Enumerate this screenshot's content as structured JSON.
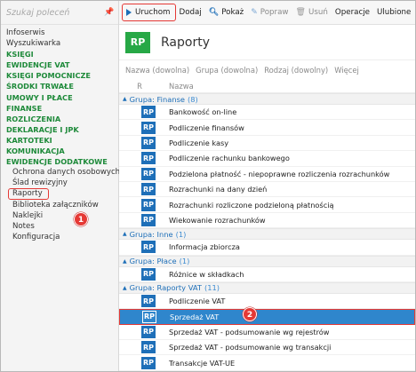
{
  "sidebar": {
    "search_placeholder": "Szukaj poleceń",
    "items": [
      {
        "label": "Infoserwis",
        "kind": "plain"
      },
      {
        "label": "Wyszukiwarka",
        "kind": "plain"
      },
      {
        "label": "KSIĘGI",
        "kind": "cat"
      },
      {
        "label": "EWIDENCJE VAT",
        "kind": "cat"
      },
      {
        "label": "KSIĘGI POMOCNICZE",
        "kind": "cat"
      },
      {
        "label": "ŚRODKI TRWAŁE",
        "kind": "cat"
      },
      {
        "label": "UMOWY I PŁACE",
        "kind": "cat"
      },
      {
        "label": "FINANSE",
        "kind": "cat"
      },
      {
        "label": "ROZLICZENIA",
        "kind": "cat"
      },
      {
        "label": "DEKLARACJE I JPK",
        "kind": "cat"
      },
      {
        "label": "KARTOTEKI",
        "kind": "cat"
      },
      {
        "label": "KOMUNIKACJA",
        "kind": "cat"
      },
      {
        "label": "EWIDENCJE DODATKOWE",
        "kind": "cat"
      },
      {
        "label": "Ochrona danych osobowych",
        "kind": "sub"
      },
      {
        "label": "Ślad rewizyjny",
        "kind": "sub"
      },
      {
        "label": "Raporty",
        "kind": "sub"
      },
      {
        "label": "Biblioteka załączników",
        "kind": "sub"
      },
      {
        "label": "Naklejki",
        "kind": "sub"
      },
      {
        "label": "Notes",
        "kind": "sub"
      },
      {
        "label": "Konfiguracja",
        "kind": "sub"
      }
    ]
  },
  "toolbar": {
    "run": "Uruchom",
    "add": "Dodaj",
    "show": "Pokaż",
    "fix": "Popraw",
    "delete": "Usuń",
    "operations": "Operacje",
    "favorites": "Ulubione"
  },
  "header": {
    "icon": "RP",
    "title": "Raporty"
  },
  "filters": [
    "Nazwa (dowolna)",
    "Grupa (dowolna)",
    "Rodzaj (dowolny)",
    "Więcej"
  ],
  "columns": {
    "r": "R",
    "name": "Nazwa"
  },
  "groups": [
    {
      "title": "Grupa: Finanse",
      "count": "(8)",
      "rows": [
        "Bankowość on-line",
        "Podliczenie finansów",
        "Podliczenie kasy",
        "Podliczenie rachunku bankowego",
        "Podzielona płatność - niepoprawne rozliczenia rozrachunków",
        "Rozrachunki na dany dzień",
        "Rozrachunki rozliczone podzieloną płatnością",
        "Wiekowanie rozrachunków"
      ]
    },
    {
      "title": "Grupa: Inne",
      "count": "(1)",
      "rows": [
        "Informacja zbiorcza"
      ]
    },
    {
      "title": "Grupa: Płace",
      "count": "(1)",
      "rows": [
        "Różnice w składkach"
      ]
    },
    {
      "title": "Grupa: Raporty VAT",
      "count": "(11)",
      "rows": [
        "Podliczenie VAT",
        "Sprzedaż VAT",
        "Sprzedaż VAT - podsumowanie wg rejestrów",
        "Sprzedaż VAT - podsumowanie wg transakcji",
        "Transakcje VAT-UE"
      ]
    }
  ],
  "row_icon": "RP",
  "selected_row": "Sprzedaż VAT",
  "badges": {
    "first": "1",
    "second": "2"
  },
  "colors": {
    "category_green": "#1e8a3a",
    "accent_blue": "#1e6fb8",
    "highlight_red": "#e53935",
    "rp_green": "#27a846"
  }
}
